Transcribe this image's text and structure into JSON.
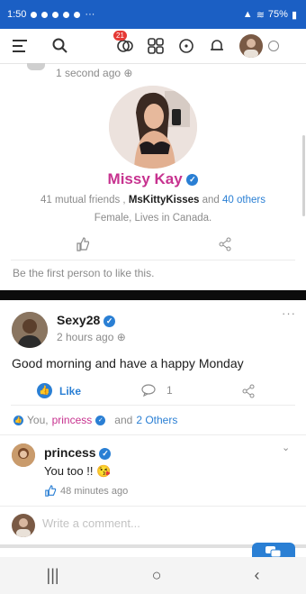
{
  "status_bar": {
    "time": "1:50",
    "more": "···",
    "battery": "75%"
  },
  "top_nav": {
    "notification_count": "21"
  },
  "post1": {
    "timestamp": "1 second ago",
    "name": "Missy Kay",
    "mutual_prefix": "41 mutual friends ,",
    "mutual_friend": "MsKittyKisses",
    "mutual_and": "and",
    "mutual_others": "40 others",
    "info": "Female, Lives in  Canada.",
    "like_prompt": "Be the first person to like this."
  },
  "post2": {
    "author": "Sexy28",
    "timestamp": "2 hours ago",
    "content": "Good morning and have a happy Monday",
    "like_label": "Like",
    "comment_count": "1",
    "reactions": {
      "you": "You,",
      "friend": "princess",
      "and": "and",
      "others": "2 Others"
    },
    "comment": {
      "author": "princess",
      "text": "You too !!",
      "time": "48 minutes ago"
    },
    "write_placeholder": "Write a comment..."
  },
  "colors": {
    "brand_blue": "#1b5fc4",
    "accent_link": "#2a7fd4",
    "name_pink": "#c7328f"
  }
}
